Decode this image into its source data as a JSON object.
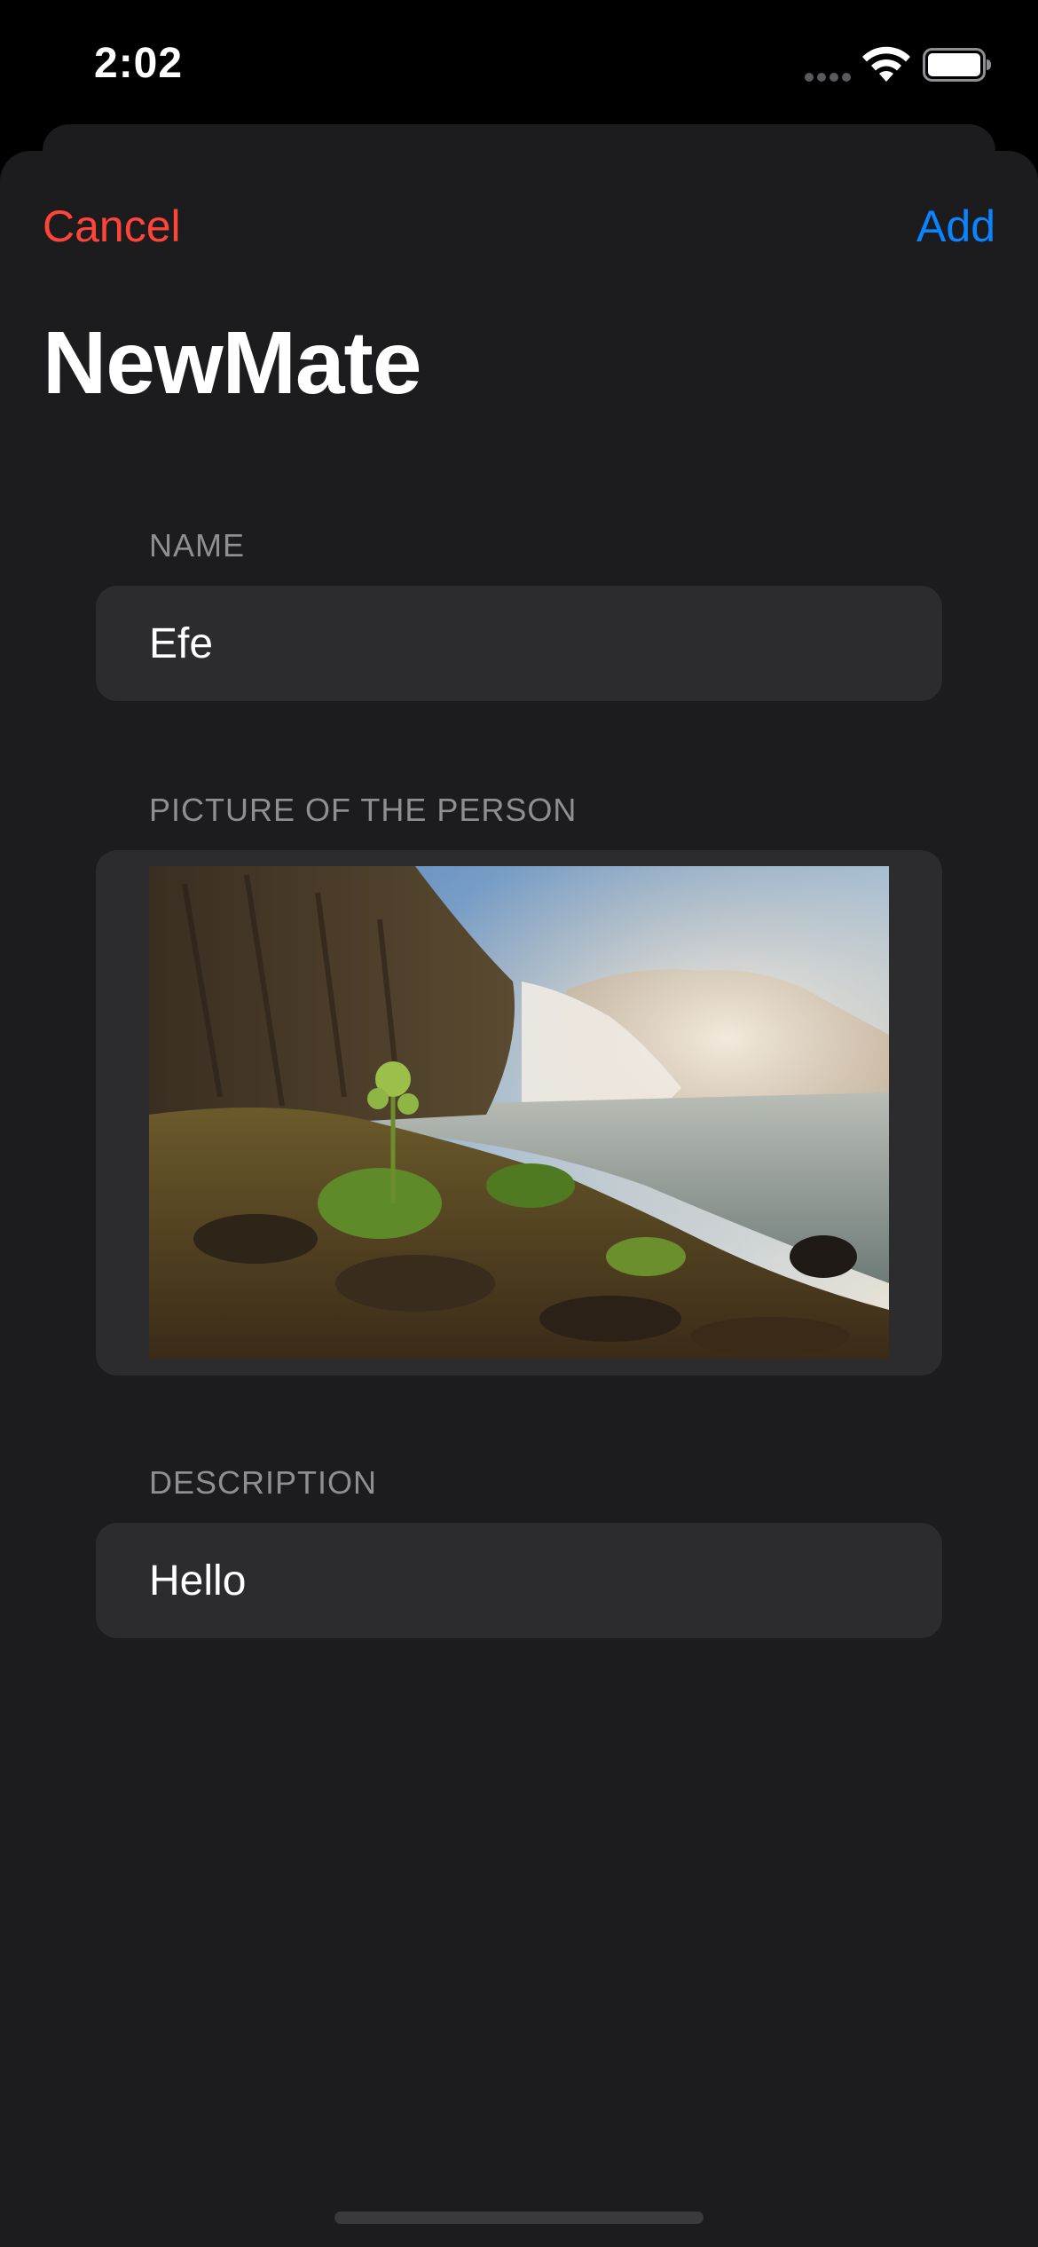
{
  "status_bar": {
    "time": "2:02"
  },
  "nav": {
    "cancel_label": "Cancel",
    "add_label": "Add"
  },
  "title": "NewMate",
  "sections": {
    "name": {
      "header": "NAME",
      "value": "Efe"
    },
    "picture": {
      "header": "PICTURE OF THE PERSON",
      "image_subject": "waterfall-landscape"
    },
    "description": {
      "header": "DESCRIPTION",
      "value": "Hello"
    }
  },
  "colors": {
    "cancel": "#ff453a",
    "add": "#0a84ff",
    "background": "#1c1c1e",
    "field": "#2c2c2e",
    "header_text": "#8e8e93"
  }
}
